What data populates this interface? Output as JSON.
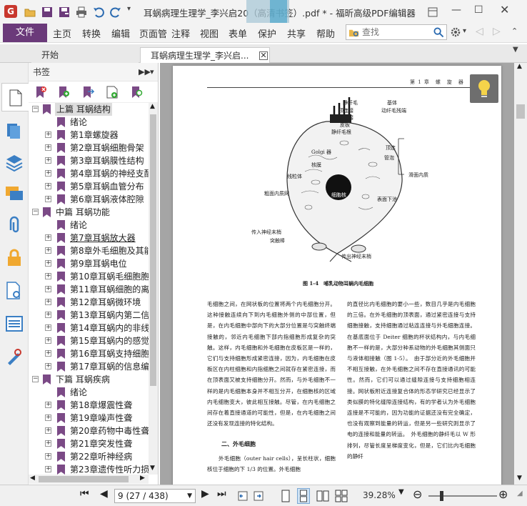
{
  "app": {
    "window_title": "耳蜗病理生理学_李兴启20（高清书签）.pdf * - 福昕高级PDF编辑器",
    "logo_letter": "G"
  },
  "ribbon": {
    "file_label": "文件",
    "tabs": [
      "主页",
      "转换",
      "编辑",
      "页面管",
      "注释",
      "视图",
      "表单",
      "保护",
      "共享",
      "帮助"
    ],
    "search_placeholder": "查找"
  },
  "doc_tabs": [
    {
      "label": "开始"
    },
    {
      "label": "耳蜗病理生理学_李兴启..."
    }
  ],
  "bookmarks": {
    "header": "书签",
    "tree": [
      {
        "label": "上篇 耳蜗结构",
        "level": 0,
        "expander": "−"
      },
      {
        "label": "绪论",
        "level": 1,
        "expander": ""
      },
      {
        "label": "第1章螺旋器",
        "level": 1,
        "expander": "+"
      },
      {
        "label": "第2章耳蜗细胞骨架",
        "level": 1,
        "expander": "+"
      },
      {
        "label": "第3章耳蜗膜性结构",
        "level": 1,
        "expander": "+"
      },
      {
        "label": "第4章耳蜗的神经支配",
        "level": 1,
        "expander": "+"
      },
      {
        "label": "第5章耳蜗血管分布",
        "level": 1,
        "expander": "+"
      },
      {
        "label": "第6章耳蜗液体腔隙",
        "level": 1,
        "expander": "+"
      },
      {
        "label": "中篇 耳蜗功能",
        "level": 0,
        "expander": "−"
      },
      {
        "label": "绪论",
        "level": 1,
        "expander": ""
      },
      {
        "label": "第7章耳蜗放大器",
        "level": 1,
        "expander": "+"
      },
      {
        "label": "第8章外毛细胞及其能动性",
        "level": 1,
        "expander": "+"
      },
      {
        "label": "第9章耳蜗电位",
        "level": 1,
        "expander": "+"
      },
      {
        "label": "第10章耳蜗毛细胞胞吞",
        "level": 1,
        "expander": "+"
      },
      {
        "label": "第11章耳蜗细胞的离子",
        "level": 1,
        "expander": "+"
      },
      {
        "label": "第12章耳蜗微环境",
        "level": 1,
        "expander": "+"
      },
      {
        "label": "第13章耳蜗内第二信使",
        "level": 1,
        "expander": "+"
      },
      {
        "label": "第14章耳蜗内的非线性",
        "level": 1,
        "expander": "+"
      },
      {
        "label": "第15章耳蜗内的感觉",
        "level": 1,
        "expander": "+"
      },
      {
        "label": "第16章耳蜗支持细胞",
        "level": 1,
        "expander": "+"
      },
      {
        "label": "第17章耳蜗的信息编码",
        "level": 1,
        "expander": "+"
      },
      {
        "label": "下篇 耳蜗疾病",
        "level": 0,
        "expander": "−"
      },
      {
        "label": "绪论",
        "level": 1,
        "expander": ""
      },
      {
        "label": "第18章爆震性聋",
        "level": 1,
        "expander": "+"
      },
      {
        "label": "第19章噪声性聋",
        "level": 1,
        "expander": "+"
      },
      {
        "label": "第20章药物中毒性聋",
        "level": 1,
        "expander": "+"
      },
      {
        "label": "第21章突发性聋",
        "level": 1,
        "expander": "+"
      },
      {
        "label": "第22章听神经病",
        "level": 1,
        "expander": "+"
      },
      {
        "label": "第23章遗传性听力损失",
        "level": 1,
        "expander": "+"
      }
    ]
  },
  "document": {
    "running_header": "第 1 章　螺　旋　器",
    "figure_caption": "图 1-4　哺乳动物耳蜗内毛细胞",
    "figure_labels": {
      "stereocilia": "静纤毛",
      "cuticular_plate_dense": "顶连接",
      "lateral_link": "侧连接",
      "cuticular_plate": "皮板",
      "rootlet": "静纤毛根",
      "kinocilium_body": "基体",
      "kino_remnant": "动纤毛残端",
      "golgi": "Golgi 器",
      "nuclear_membrane": "核膜",
      "mitochondria": "线粒体",
      "rough_er": "粗面内质网",
      "nucleus": "细胞核",
      "afferent_terminal": "传入神经末梢",
      "synaptic_ribbon": "突触棒",
      "efferent_terminal": "传出神经末梢",
      "top_junction": "顶连",
      "vesicles": "管泡",
      "smooth_er": "滑面内质",
      "surface_sub": "表面下池"
    },
    "left_column": "毛细胞之间，在网状板的位置将两个内毛细胞分开。这种接触连续向下到内毛细胞外侧的中部位置，但是，在内毛细胞中部向下的大部分位置是与突触终端接触的，邻近内毛细胞下部内指细胞形成复杂的突触。这样，内毛细胞和外毛细胞在皮板区是一样的，它们与支持细胞形成紧密连接，因为，内毛细胞在皮板区在内柱细胞和内指细胞之间就存在紧密连接，而在顶表面又被支持细胞分开。然而，与外毛细胞不一样的是内毛细胞本身并不相互分开，在细胞核的区域内毛细胞变大，彼此相互接触。尽管，在内毛细胞之间存在着直接通道的可能性，但是，在内毛细胞之间还没有发现连接的特化结构。",
    "section_title": "二、外毛细胞",
    "left_column_2": "外毛细胞（outer hair cells），呈长柱状，细胞核位于细胞的下 1/3 的位置。外毛细胞",
    "right_column": "的直径比内毛细胞的要小一些，数目几乎是内毛细胞的三倍。在外毛细胞的顶表面，通过紧密连接与支持细胞接触，支持细胞通过粘连连接与外毛细胞连接。在基底面位于 Deiter 细胞的杯状结构内，与内毛细胞不一样的是，大部分种系动物的外毛细胞其侧面只与液体相接触（图 1-5）。　由于部分近的外毛细胞并不相互接触，在外毛细胞之间不存在直接通讯的可能性。然而，它们可以通过缝隙连接与支持细胞相连接。网状板附近连接复合体的形态学研究已经显示了类似膜的特化缝隙连接结构，有的学者认为外毛细胞连接是不可能的，因为功能的证据还没有完全确定，也没有观察到能量的转运，但是另一些研究则显示了电的连接和能量的转运。　外毛细胞的静纤毛以 W 形排列，尽管长度呈梯度变化，但是，它们比内毛细胞的静纤"
  },
  "status": {
    "page_indicator": "9 (27 / 438)",
    "zoom": "39.28%"
  }
}
